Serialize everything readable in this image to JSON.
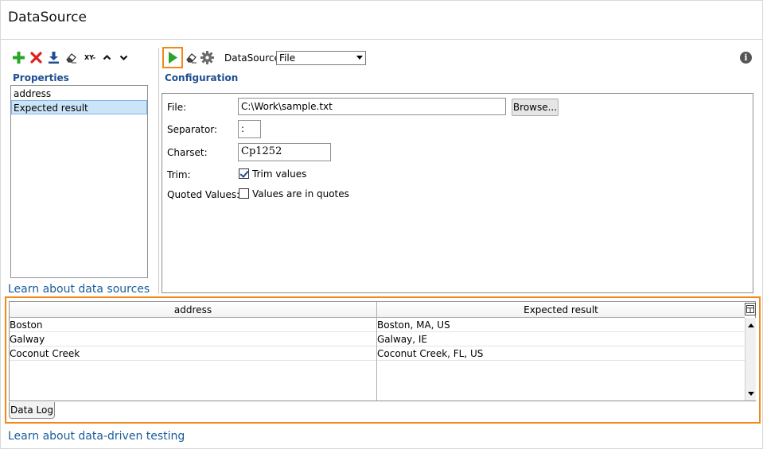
{
  "window": {
    "title": "DataSource"
  },
  "left_toolbar": {
    "icons": [
      "add-icon",
      "delete-icon",
      "download-icon",
      "eraser-icon",
      "xy-icon",
      "move-up-icon",
      "move-down-icon"
    ],
    "xy_label": "XY-"
  },
  "properties": {
    "label": "Properties",
    "items": [
      {
        "label": "address",
        "selected": false
      },
      {
        "label": "Expected result",
        "selected": true
      }
    ]
  },
  "links": {
    "data_sources": "Learn about data sources",
    "data_driven": "Learn about data-driven testing"
  },
  "right_toolbar": {
    "datasource_label": "DataSource:",
    "datasource_value": "File"
  },
  "configuration": {
    "label": "Configuration",
    "file_label": "File:",
    "file_value": "C:\\Work\\sample.txt",
    "browse_label": "Browse...",
    "separator_label": "Separator:",
    "separator_value": ":",
    "charset_label": "Charset:",
    "charset_value": "Cp1252",
    "trim_label": "Trim:",
    "trim_checkbox_label": "Trim values",
    "trim_checked": true,
    "quoted_label": "Quoted Values:",
    "quoted_checkbox_label": "Values are in quotes",
    "quoted_checked": false
  },
  "grid": {
    "columns": [
      "address",
      "Expected result"
    ],
    "rows": [
      [
        "Boston",
        "Boston, MA, US"
      ],
      [
        "Galway",
        "Galway, IE"
      ],
      [
        "Coconut Creek",
        "Coconut Creek, FL, US"
      ]
    ]
  },
  "tabs": {
    "data_log": "Data Log"
  },
  "colors": {
    "highlight": "#f0891a",
    "accent_text": "#1f4e91",
    "link": "#1a5d9c",
    "add": "#2aa52a",
    "delete": "#e0201c",
    "run": "#2aa52a"
  }
}
